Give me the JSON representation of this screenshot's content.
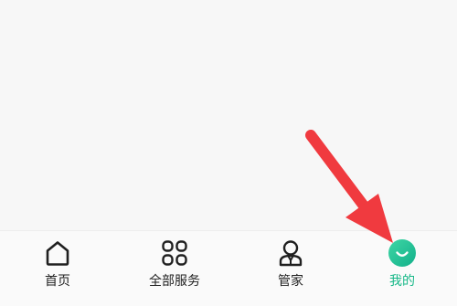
{
  "tabbar": {
    "tabs": [
      {
        "label": "首页",
        "icon": "home-icon",
        "active": false
      },
      {
        "label": "全部服务",
        "icon": "grid-icon",
        "active": false
      },
      {
        "label": "管家",
        "icon": "person-icon",
        "active": false
      },
      {
        "label": "我的",
        "icon": "smile-avatar-icon",
        "active": true
      }
    ]
  },
  "colors": {
    "active": "#17b888",
    "arrow": "#f03a3f",
    "text": "#1f1f1f"
  }
}
